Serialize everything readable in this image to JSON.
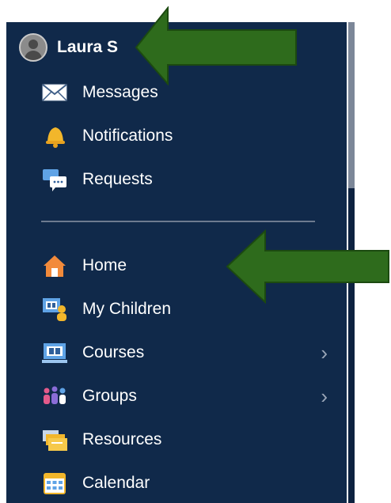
{
  "user": {
    "name": "Laura S"
  },
  "menu_top": [
    {
      "label": "Messages",
      "icon": "envelope-icon"
    },
    {
      "label": "Notifications",
      "icon": "bell-icon"
    },
    {
      "label": "Requests",
      "icon": "chat-bubbles-icon"
    }
  ],
  "menu_main": [
    {
      "label": "Home",
      "icon": "home-icon"
    },
    {
      "label": "My Children",
      "icon": "children-icon"
    },
    {
      "label": "Courses",
      "icon": "courses-icon",
      "has_submenu": true
    },
    {
      "label": "Groups",
      "icon": "groups-icon",
      "has_submenu": true
    },
    {
      "label": "Resources",
      "icon": "folders-icon"
    },
    {
      "label": "Calendar",
      "icon": "calendar-icon"
    }
  ],
  "colors": {
    "panel": "#10294a",
    "annotation_arrow": "#2e6b1c"
  }
}
